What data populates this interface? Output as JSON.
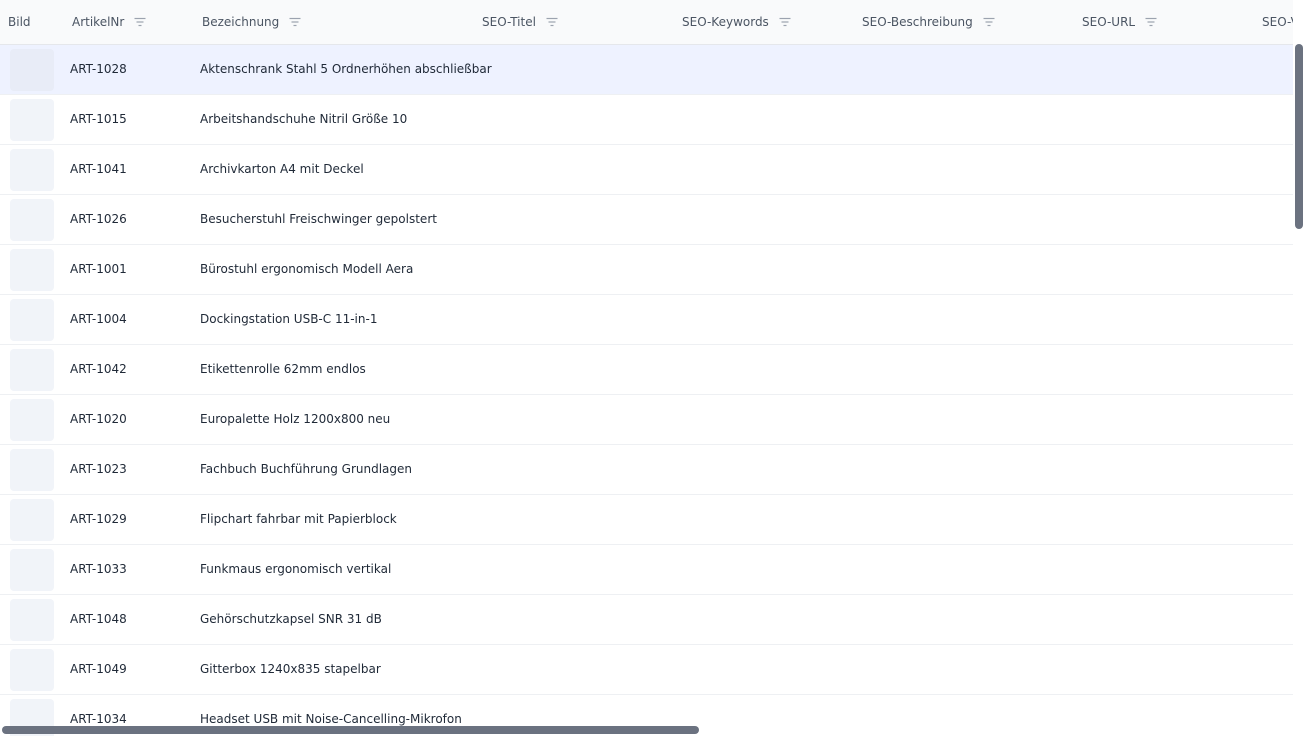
{
  "columns": {
    "image": "Bild",
    "article_no": "ArtikelNr",
    "description": "Bezeichnung",
    "seo_title": "SEO-Titel",
    "seo_keywords": "SEO-Keywords",
    "seo_description": "SEO-Beschreibung",
    "seo_url": "SEO-URL",
    "seo_v": "SEO-V"
  },
  "icons": {
    "filter": "filter-icon"
  },
  "rows": [
    {
      "article_no": "ART-1028",
      "description": "Aktenschrank Stahl 5 Ordnerhöhen abschließbar"
    },
    {
      "article_no": "ART-1015",
      "description": "Arbeitshandschuhe Nitril Größe 10"
    },
    {
      "article_no": "ART-1041",
      "description": "Archivkarton A4 mit Deckel"
    },
    {
      "article_no": "ART-1026",
      "description": "Besucherstuhl Freischwinger gepolstert"
    },
    {
      "article_no": "ART-1001",
      "description": "Bürostuhl ergonomisch Modell Aera"
    },
    {
      "article_no": "ART-1004",
      "description": "Dockingstation USB-C 11-in-1"
    },
    {
      "article_no": "ART-1042",
      "description": "Etikettenrolle 62mm endlos"
    },
    {
      "article_no": "ART-1020",
      "description": "Europalette Holz 1200x800 neu"
    },
    {
      "article_no": "ART-1023",
      "description": "Fachbuch Buchführung Grundlagen"
    },
    {
      "article_no": "ART-1029",
      "description": "Flipchart fahrbar mit Papierblock"
    },
    {
      "article_no": "ART-1033",
      "description": "Funkmaus ergonomisch vertikal"
    },
    {
      "article_no": "ART-1048",
      "description": "Gehörschutzkapsel SNR 31 dB"
    },
    {
      "article_no": "ART-1049",
      "description": "Gitterbox 1240x835 stapelbar"
    },
    {
      "article_no": "ART-1034",
      "description": "Headset USB mit Noise-Cancelling-Mikrofon"
    }
  ],
  "colors": {
    "selected_row": "#eef2ff",
    "header_bg": "#f9fafb",
    "scrollbar": "#6b7280"
  }
}
